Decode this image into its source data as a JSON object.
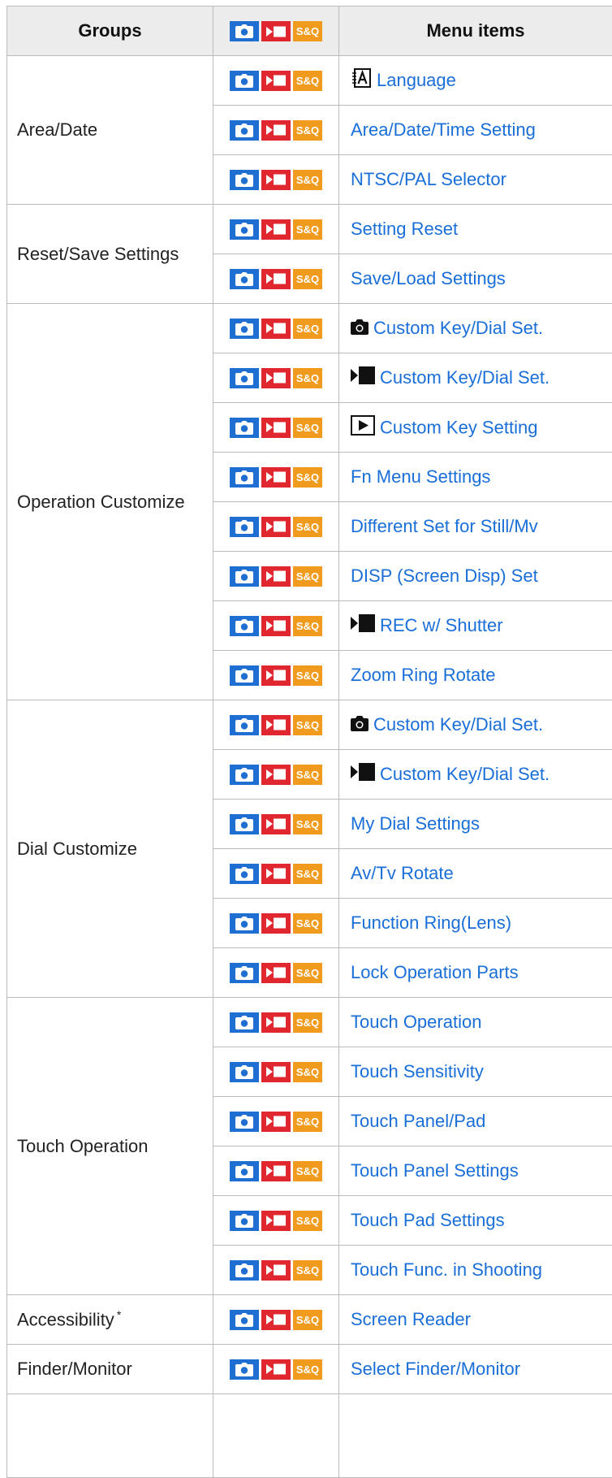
{
  "colors": {
    "link": "#1a6ed8",
    "photo": "#1e6fd1",
    "movie": "#e0262e",
    "sq": "#f09a1e"
  },
  "table": {
    "headers": {
      "groups": "Groups",
      "menu_items": "Menu items"
    },
    "mode_badges": [
      "photo-mode-icon",
      "movie-mode-icon",
      "sq-mode-icon"
    ],
    "sq_label": "S&Q",
    "groups": [
      {
        "label": "Area/Date",
        "asterisk": "",
        "items": [
          {
            "text": "Language",
            "icon": "language-icon"
          },
          {
            "text": "Area/Date/Time Setting",
            "icon": ""
          },
          {
            "text": "NTSC/PAL Selector",
            "icon": ""
          }
        ]
      },
      {
        "label": "Reset/Save Settings",
        "asterisk": "",
        "items": [
          {
            "text": "Setting Reset",
            "icon": ""
          },
          {
            "text": "Save/Load Settings",
            "icon": ""
          }
        ]
      },
      {
        "label": "Operation Customize",
        "asterisk": "",
        "items": [
          {
            "text": "Custom Key/Dial Set.",
            "icon": "camera-icon"
          },
          {
            "text": "Custom Key/Dial Set.",
            "icon": "movie-icon"
          },
          {
            "text": "Custom Key Setting",
            "icon": "playback-icon"
          },
          {
            "text": "Fn Menu Settings",
            "icon": ""
          },
          {
            "text": "Different Set for Still/Mv",
            "icon": ""
          },
          {
            "text": "DISP (Screen Disp) Set",
            "icon": ""
          },
          {
            "text": "REC w/ Shutter",
            "icon": "movie-icon"
          },
          {
            "text": "Zoom Ring Rotate",
            "icon": ""
          }
        ]
      },
      {
        "label": "Dial Customize",
        "asterisk": "",
        "items": [
          {
            "text": "Custom Key/Dial Set.",
            "icon": "camera-icon"
          },
          {
            "text": "Custom Key/Dial Set.",
            "icon": "movie-icon"
          },
          {
            "text": "My Dial Settings",
            "icon": ""
          },
          {
            "text": "Av/Tv Rotate",
            "icon": ""
          },
          {
            "text": "Function Ring(Lens)",
            "icon": ""
          },
          {
            "text": "Lock Operation Parts",
            "icon": ""
          }
        ]
      },
      {
        "label": "Touch Operation",
        "asterisk": "",
        "items": [
          {
            "text": "Touch Operation",
            "icon": ""
          },
          {
            "text": "Touch Sensitivity",
            "icon": ""
          },
          {
            "text": "Touch Panel/Pad",
            "icon": ""
          },
          {
            "text": "Touch Panel Settings",
            "icon": ""
          },
          {
            "text": "Touch Pad Settings",
            "icon": ""
          },
          {
            "text": "Touch Func. in Shooting",
            "icon": ""
          }
        ]
      },
      {
        "label": "Accessibility",
        "asterisk": "*",
        "items": [
          {
            "text": "Screen Reader",
            "icon": ""
          }
        ]
      },
      {
        "label": "Finder/Monitor",
        "asterisk": "",
        "items": [
          {
            "text": "Select Finder/Monitor",
            "icon": ""
          }
        ]
      }
    ]
  }
}
